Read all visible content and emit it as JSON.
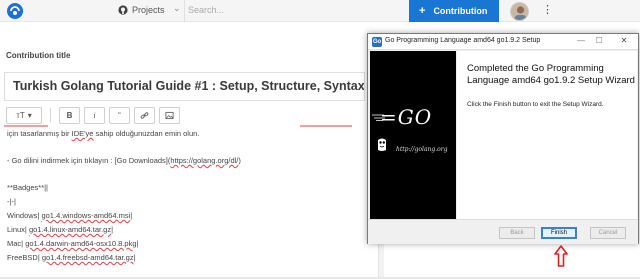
{
  "topbar": {
    "projects_label": "Projects",
    "search_placeholder": "Search...",
    "contribution_label": "Contribution",
    "colors": {
      "bar_bg": "#f5f5f5",
      "accent": "#1976d2"
    },
    "icons": [
      "logo-icon",
      "github-icon",
      "chevron-down-icon",
      "plus-icon",
      "avatar",
      "kebab-menu-icon"
    ]
  },
  "editor": {
    "section_label": "Contribution title",
    "title_value": "Turkish Golang Tutorial Guide #1 : Setup, Structure, Syntax",
    "toolbar": {
      "heading_label": "ᴛT",
      "bold_label": "B",
      "italic_label": "i",
      "quote_label": "“",
      "icons": [
        "chevron-down-icon",
        "link-icon",
        "image-icon"
      ]
    },
    "lines": {
      "l1a": "için tasarlanmış bir ",
      "l1b": "IDE'ye",
      "l1c": " sahip olduğunuzdan emin olun.",
      "l2a": "- Go dilini indirmek için tıklayın : [Go Downloads](",
      "l2b": "https://golang.org/dl/",
      "l2c": ")",
      "l3": "**Badges**||",
      "l4": "-|-|",
      "l5a": "Windows| ",
      "l5b": "go1.4.windows-amd64.msi",
      "l5c": "|",
      "l6a": "Linux| ",
      "l6b": "go1.4.linux-amd64.tar.gz",
      "l6c": "|",
      "l7a": "Mac| ",
      "l7b": "go1.4.darwin-amd64-osx10.8.pkg",
      "l7c": "|",
      "l8a": "FreeBSD| ",
      "l8b": "go1.4.freebsd-amd64.tar.gz",
      "l8c": "|"
    }
  },
  "dialog": {
    "icon_text": "Go",
    "window_title": "Go Programming Language amd64 go1.9.2 Setup",
    "minimize": "—",
    "maximize": "☐",
    "close": "✕",
    "logo_text": "=GO",
    "url_text": "http://golang.org",
    "heading": "Completed the Go Programming Language amd64 go1.9.2 Setup Wizard",
    "body": "Click the Finish button to exit the Setup Wizard.",
    "buttons": {
      "back": "Back",
      "finish": "Finish",
      "cancel": "Cancel"
    },
    "colors": {
      "side_panel": "#000000",
      "annotation_arrow": "#e02020"
    }
  }
}
